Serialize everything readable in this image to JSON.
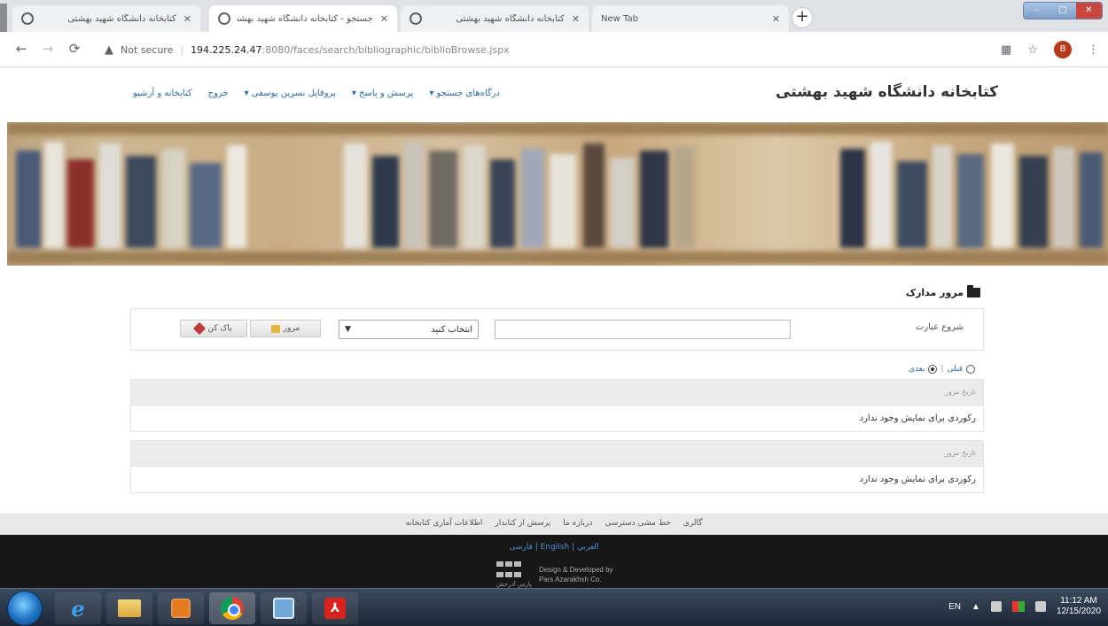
{
  "browser": {
    "tabs": [
      {
        "title": "کتابخانه دانشگاه شهید بهشتی",
        "active": false
      },
      {
        "title": "جستجو - کتابخانه دانشگاه شهید بهشتی",
        "active": true
      },
      {
        "title": "کتابخانه دانشگاه شهید بهشتی",
        "active": false
      },
      {
        "title": "New Tab",
        "active": false
      }
    ],
    "new_tab_symbol": "+",
    "security_label": "Not secure",
    "url_host": "194.225.24.47",
    "url_path": ":8080/faces/search/bibliographic/biblioBrowse.jspx",
    "profile_initial": "B"
  },
  "site": {
    "title": "کتابخانه دانشگاه شهید بهشتی",
    "menu": [
      "درگاه‌های جستجو ▾",
      "پرسش و پاسخ ▾",
      "پروفایل نسرین یوسفی ▾",
      "خروج",
      "کتابخانه و آرشیو"
    ]
  },
  "main": {
    "heading": "مرور مدارک",
    "search": {
      "label": "شروع عبارت",
      "input_value": "",
      "select_value": "انتخاب کنید",
      "browse_label": "مرور",
      "clear_label": "پاک کن"
    },
    "radios": {
      "option_1": "قبلی",
      "separator": "|",
      "option_2": "بعدی",
      "selected": "بعدی"
    },
    "results": [
      {
        "header": "تاریخ مرور",
        "message": "رکوردی برای نمایش وجود ندارد"
      },
      {
        "header": "تاریخ مرور",
        "message": "رکوردی برای نمایش وجود ندارد"
      }
    ]
  },
  "footer": {
    "links": [
      "گالری",
      "خط مشی دسترسی",
      "درباره ما",
      "پرسش از کتابدار",
      "اطلاعات آماری کتابخانه"
    ],
    "languages": "فارسی | English | العربي",
    "credit_line_1": "Design & Developed by",
    "credit_line_2": "Pars Azarakhsh Co.",
    "logo_caption": "پارس آذرخش"
  },
  "taskbar": {
    "language": "EN",
    "time": "11:12 AM",
    "date": "12/15/2020"
  },
  "colors": {
    "link": "#2a6db0",
    "footer_dark": "#171717",
    "panel_header": "#ececec"
  }
}
